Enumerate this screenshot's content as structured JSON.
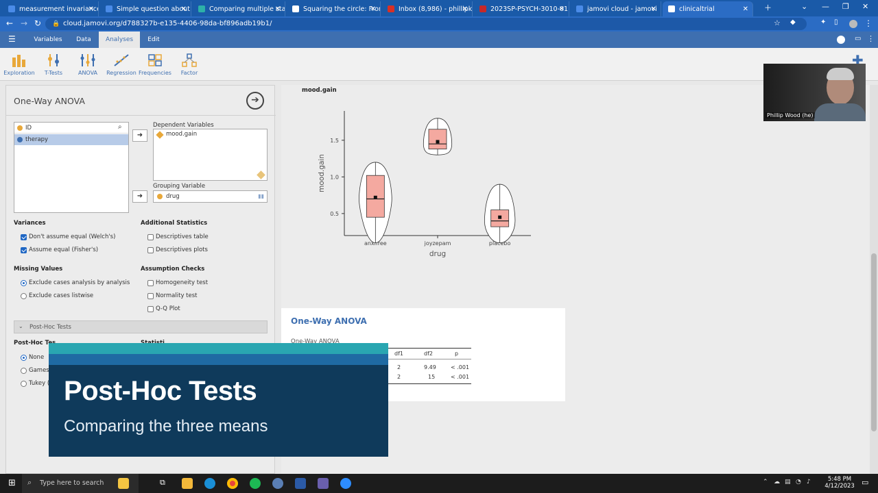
{
  "browser": {
    "tabs": [
      {
        "label": "measurement invariance \"",
        "color": "#4a8be8"
      },
      {
        "label": "Simple question about inte",
        "color": "#4a8be8"
      },
      {
        "label": "Comparing multiple statist",
        "color": "#2db1a8"
      },
      {
        "label": "Squaring the circle: From",
        "color": "#ffffff"
      },
      {
        "label": "Inbox (8,986) - phillipkwo",
        "color": "#d93025"
      },
      {
        "label": "2023SP-PSYCH-3010-01",
        "color": "#c62828"
      },
      {
        "label": "jamovi cloud - jamovi",
        "color": "#4a8be8"
      },
      {
        "label": "clinicaltrial",
        "color": "#ffffff"
      }
    ],
    "url": "cloud.jamovi.org/d788327b-e135-4406-98da-bf896adb19b1/"
  },
  "jamovi": {
    "menu_tabs": [
      "Variables",
      "Data",
      "Analyses",
      "Edit"
    ],
    "ribbon": [
      "Exploration",
      "T-Tests",
      "ANOVA",
      "Regression",
      "Frequencies",
      "Factor"
    ],
    "panel_title": "One-Way ANOVA",
    "variable_list": [
      "ID",
      "therapy"
    ],
    "dependent_label": "Dependent Variables",
    "dependent_value": "mood.gain",
    "grouping_label": "Grouping Variable",
    "grouping_value": "drug",
    "variances_label": "Variances",
    "welch_label": "Don't assume equal (Welch's)",
    "fisher_label": "Assume equal (Fisher's)",
    "additional_label": "Additional Statistics",
    "desc_table": "Descriptives table",
    "desc_plots": "Descriptives plots",
    "missing_label": "Missing Values",
    "excl_analysis": "Exclude cases analysis by analysis",
    "excl_listwise": "Exclude cases listwise",
    "assumption_label": "Assumption Checks",
    "homogeneity": "Homogeneity test",
    "normality": "Normality test",
    "qq_plot": "Q-Q Plot",
    "posthoc_section": "Post-Hoc Tests",
    "posthoc_test_label": "Post-Hoc Tes",
    "stats_label": "Statisti",
    "posthoc_none": "None",
    "posthoc_games": "Games-",
    "posthoc_tukey": "Tukey (",
    "plot_title": "mood.gain",
    "results_title": "One-Way ANOVA",
    "results_sub": "One-Way ANOVA",
    "table_headers": [
      "df1",
      "df2",
      "p"
    ],
    "table_rows": [
      {
        "df1": "2",
        "df2": "9.49",
        "p": "< .001"
      },
      {
        "df1": "2",
        "df2": "15",
        "p": "< .001"
      }
    ]
  },
  "chart_data": {
    "type": "violin-box",
    "categories": [
      "anxifree",
      "joyzepam",
      "placebo"
    ],
    "xlabel": "drug",
    "ylabel": "mood.gain",
    "ylim": [
      0.2,
      1.9
    ],
    "yticks": [
      "0.5",
      "1.0",
      "1.5"
    ],
    "boxes": [
      {
        "category": "anxifree",
        "q1": 0.45,
        "median": 0.7,
        "q3": 1.02,
        "mean": 0.72,
        "min": 0.1,
        "max": 1.2
      },
      {
        "category": "joyzepam",
        "q1": 1.38,
        "median": 1.45,
        "q3": 1.65,
        "mean": 1.48,
        "min": 1.3,
        "max": 1.8
      },
      {
        "category": "placebo",
        "q1": 0.32,
        "median": 0.4,
        "q3": 0.55,
        "mean": 0.45,
        "min": 0.1,
        "max": 0.9
      }
    ],
    "box_color": "#f4a9a0"
  },
  "overlay": {
    "title": "Post-Hoc Tests",
    "subtitle": "Comparing the three means"
  },
  "webcam": {
    "name": "Phillip Wood (he)"
  },
  "taskbar": {
    "search_placeholder": "Type here to search",
    "time": "5:48 PM",
    "date": "4/12/2023"
  }
}
